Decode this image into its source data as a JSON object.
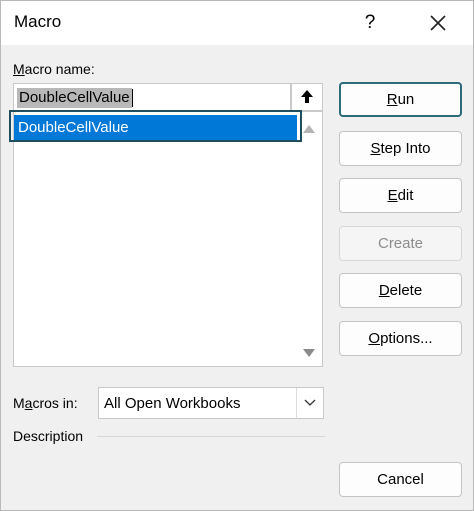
{
  "dialog": {
    "title": "Macro",
    "help": "?"
  },
  "macro_name": {
    "label_accel": "M",
    "label_rest": "acro name:",
    "value": "DoubleCellValue"
  },
  "macro_list": {
    "items": [
      "DoubleCellValue"
    ],
    "selected_index": 0
  },
  "buttons": {
    "run": {
      "accel": "R",
      "rest": "un"
    },
    "step_into": {
      "accel": "S",
      "rest": "tep Into"
    },
    "edit": {
      "accel": "E",
      "rest": "dit"
    },
    "create": {
      "label": "Create"
    },
    "delete": {
      "accel": "D",
      "rest": "elete"
    },
    "options": {
      "accel": "O",
      "rest": "ptions..."
    },
    "cancel": {
      "label": "Cancel"
    }
  },
  "macros_in": {
    "label_pre": "M",
    "label_accel": "a",
    "label_rest": "cros in:",
    "value": "All Open Workbooks"
  },
  "description": {
    "label": "Description"
  },
  "colors": {
    "selection": "#0078d7",
    "focus_border": "#2b6b7a"
  }
}
